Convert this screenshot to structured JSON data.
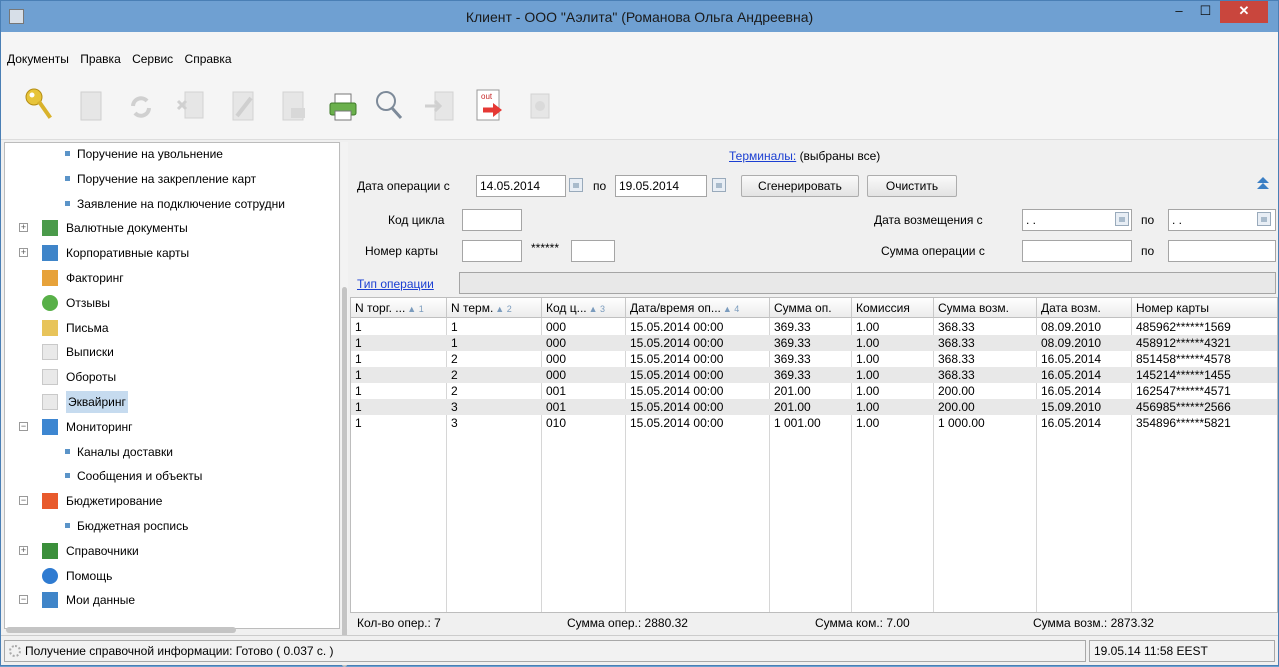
{
  "window": {
    "title": "Клиент - ООО \"Аэлита\" (Романова Ольга Андреевна)",
    "min": "–",
    "max": "☐",
    "close": "✕"
  },
  "menu": [
    "Документы",
    "Правка",
    "Сервис",
    "Справка"
  ],
  "toolbar_icons": [
    "key-icon",
    "document-icon",
    "refresh-icon",
    "delete-icon",
    "sign-icon",
    "edit-icon",
    "send-icon",
    "printer-icon",
    "search-icon",
    "import-icon",
    "export-out-icon",
    "archive-icon"
  ],
  "toolbar": {
    "out_label": "out"
  },
  "sidebar": {
    "items": [
      {
        "label": "Поручение на увольнение",
        "type": "child"
      },
      {
        "label": "Поручение на закрепление карт",
        "type": "child"
      },
      {
        "label": "Заявление на подключение сотрудни",
        "type": "child"
      },
      {
        "label": "Валютные документы",
        "type": "folder",
        "icon": "currency-docs-icon"
      },
      {
        "label": "Корпоративные карты",
        "type": "folder",
        "icon": "corporate-cards-icon"
      },
      {
        "label": "Факторинг",
        "type": "leaf",
        "icon": "factoring-icon"
      },
      {
        "label": "Отзывы",
        "type": "leaf",
        "icon": "recall-icon"
      },
      {
        "label": "Письма",
        "type": "leaf",
        "icon": "letters-icon"
      },
      {
        "label": "Выписки",
        "type": "leaf",
        "icon": "statement-icon"
      },
      {
        "label": "Обороты",
        "type": "leaf",
        "icon": "turnover-icon"
      },
      {
        "label": "Эквайринг",
        "type": "leaf",
        "icon": "acquiring-icon",
        "selected": true
      },
      {
        "label": "Мониторинг",
        "type": "expanded",
        "icon": "monitoring-icon"
      },
      {
        "label": "Каналы доставки",
        "type": "child"
      },
      {
        "label": "Сообщения и объекты",
        "type": "child"
      },
      {
        "label": "Бюджетирование",
        "type": "expanded",
        "icon": "budgeting-icon"
      },
      {
        "label": "Бюджетная роспись",
        "type": "child"
      },
      {
        "label": "Справочники",
        "type": "folder",
        "icon": "reference-books-icon"
      },
      {
        "label": "Помощь",
        "type": "leaf",
        "icon": "help-icon"
      },
      {
        "label": "Мои данные",
        "type": "expanded",
        "icon": "my-data-icon"
      }
    ]
  },
  "filters": {
    "terminals_link": "Терминалы:",
    "terminals_value": "(выбраны все)",
    "date_from_label": "Дата операции с",
    "date_from": "14.05.2014",
    "to_label": "по",
    "date_to": "19.05.2014",
    "generate_button": "Сгенерировать",
    "clear_button": "Очистить",
    "cycle_code_label": "Код цикла",
    "cycle_code": "",
    "card_number_label": "Номер карты",
    "card_prefix": "",
    "card_mask": "******",
    "card_suffix": "",
    "refund_date_label": "Дата возмещения с",
    "refund_date_from": " .  .",
    "refund_date_to": " .  .",
    "amount_label": "Сумма операции с",
    "amount_from": "",
    "amount_to": "",
    "op_type_link": "Тип операции",
    "op_type": ""
  },
  "table": {
    "columns": [
      {
        "label": "N торг. ...",
        "sort": "▲ 1"
      },
      {
        "label": "N терм.",
        "sort": "▲ 2"
      },
      {
        "label": "Код ц...",
        "sort": "▲ 3"
      },
      {
        "label": "Дата/время оп...",
        "sort": "▲ 4"
      },
      {
        "label": "Сумма оп.",
        "sort": ""
      },
      {
        "label": "Комиссия",
        "sort": ""
      },
      {
        "label": "Сумма возм.",
        "sort": ""
      },
      {
        "label": "Дата возм.",
        "sort": ""
      },
      {
        "label": "Номер карты",
        "sort": ""
      }
    ],
    "rows": [
      [
        "1",
        "1",
        "000",
        "15.05.2014 00:00",
        "369.33",
        "1.00",
        "368.33",
        "08.09.2010",
        "485962******1569"
      ],
      [
        "1",
        "1",
        "000",
        "15.05.2014 00:00",
        "369.33",
        "1.00",
        "368.33",
        "08.09.2010",
        "458912******4321"
      ],
      [
        "1",
        "2",
        "000",
        "15.05.2014 00:00",
        "369.33",
        "1.00",
        "368.33",
        "16.05.2014",
        "851458******4578"
      ],
      [
        "1",
        "2",
        "000",
        "15.05.2014 00:00",
        "369.33",
        "1.00",
        "368.33",
        "16.05.2014",
        "145214******1455"
      ],
      [
        "1",
        "2",
        "001",
        "15.05.2014 00:00",
        "201.00",
        "1.00",
        "200.00",
        "16.05.2014",
        "162547******4571"
      ],
      [
        "1",
        "3",
        "001",
        "15.05.2014 00:00",
        "201.00",
        "1.00",
        "200.00",
        "15.09.2010",
        "456985******2566"
      ],
      [
        "1",
        "3",
        "010",
        "15.05.2014 00:00",
        "1 001.00",
        "1.00",
        "1 000.00",
        "16.05.2014",
        "354896******5821"
      ]
    ]
  },
  "totals": {
    "count": "Кол-во опер.: 7",
    "amount": "Сумма опер.: 2880.32",
    "commission": "Сумма ком.: 7.00",
    "refund": "Сумма возм.: 2873.32"
  },
  "status": {
    "message": "Получение справочной информации: Готово ( 0.037 с. )",
    "datetime": "19.05.14 11:58 EEST"
  }
}
